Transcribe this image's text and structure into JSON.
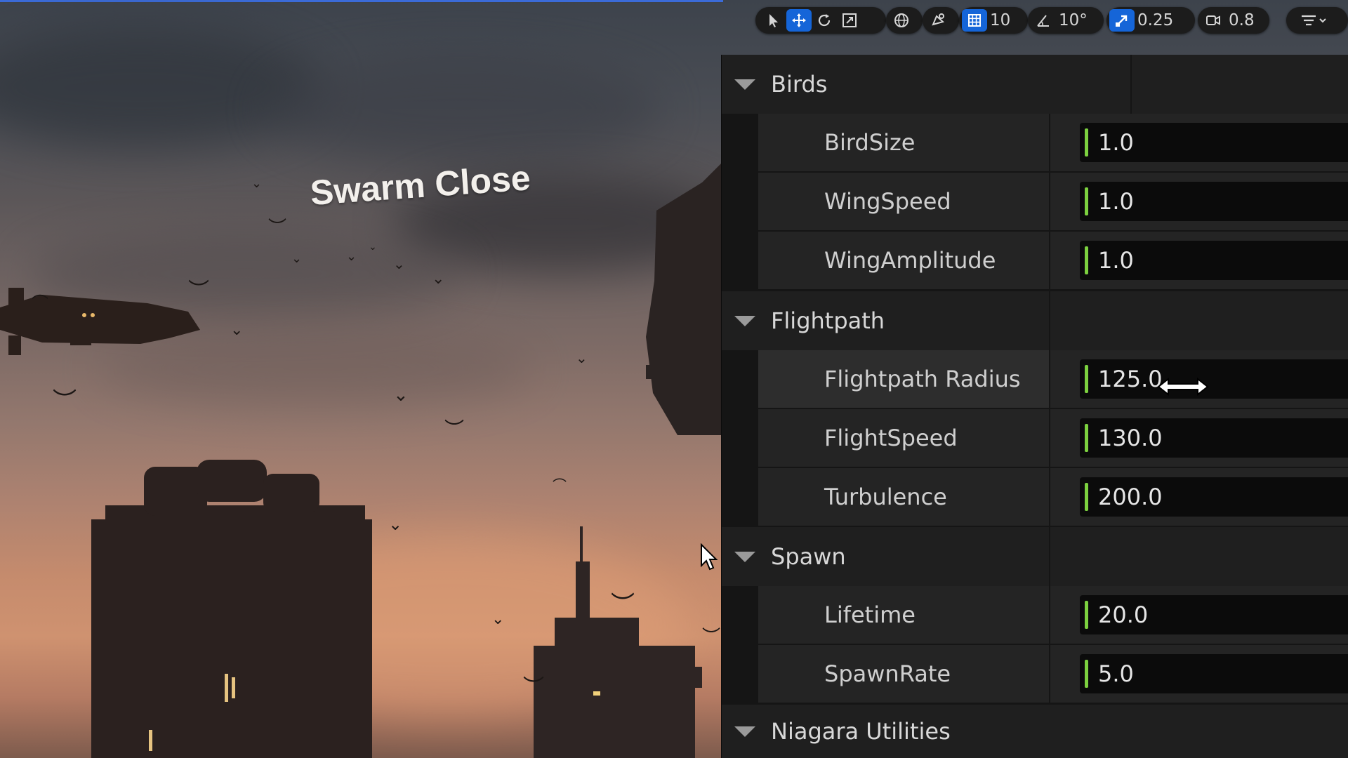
{
  "viewport": {
    "overlay_title": "Swarm Close"
  },
  "toolbar": {
    "select_icon": "select-arrow-icon",
    "translate_icon": "translate-icon",
    "rotate_icon": "rotate-icon",
    "scale_icon": "scale-icon",
    "world_local_icon": "globe-icon",
    "surface_snap_icon": "surface-snap-icon",
    "grid_snap_icon": "grid-icon",
    "grid_snap_value": "10",
    "angle_snap_icon": "angle-icon",
    "angle_snap_value": "10°",
    "scale_snap_icon": "scale-snap-icon",
    "scale_snap_value": "0.25",
    "camera_speed_icon": "camera-icon",
    "camera_speed_value": "0.8",
    "settings_icon": "filter-menu-icon",
    "accent_color": "#1565d8"
  },
  "details": {
    "field_accent_color": "#7cd13f",
    "sections": {
      "birds": {
        "label": "Birds",
        "props": [
          {
            "name": "BirdSize",
            "value": "1.0"
          },
          {
            "name": "WingSpeed",
            "value": "1.0"
          },
          {
            "name": "WingAmplitude",
            "value": "1.0"
          }
        ]
      },
      "flightpath": {
        "label": "Flightpath",
        "props": [
          {
            "name": "Flightpath Radius",
            "value": "125.0"
          },
          {
            "name": "FlightSpeed",
            "value": "130.0"
          },
          {
            "name": "Turbulence",
            "value": "200.0"
          }
        ]
      },
      "spawn": {
        "label": "Spawn",
        "props": [
          {
            "name": "Lifetime",
            "value": "20.0"
          },
          {
            "name": "SpawnRate",
            "value": "5.0"
          }
        ]
      },
      "niagara": {
        "label": "Niagara Utilities"
      }
    }
  }
}
